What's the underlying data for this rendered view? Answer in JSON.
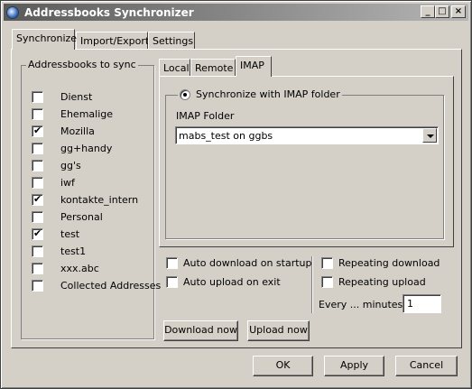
{
  "window": {
    "title": "Addressbooks Synchronizer"
  },
  "title_buttons": {
    "minimize": "_",
    "maximize": "□",
    "close": "×"
  },
  "main_tabs": [
    {
      "label": "Synchronize",
      "active": true
    },
    {
      "label": "Import/Export",
      "active": false
    },
    {
      "label": "Settings",
      "active": false
    }
  ],
  "addressbooks": {
    "group_label": "Addressbooks to sync",
    "items": [
      {
        "label": "Dienst",
        "checked": false
      },
      {
        "label": "Ehemalige",
        "checked": false
      },
      {
        "label": "Mozilla",
        "checked": true
      },
      {
        "label": "gg+handy",
        "checked": false
      },
      {
        "label": "gg's",
        "checked": false
      },
      {
        "label": "iwf",
        "checked": false
      },
      {
        "label": "kontakte_intern",
        "checked": true
      },
      {
        "label": "Personal",
        "checked": false
      },
      {
        "label": "test",
        "checked": true
      },
      {
        "label": "test1",
        "checked": false
      },
      {
        "label": "xxx.abc",
        "checked": false
      },
      {
        "label": "Collected Addresses",
        "checked": false
      }
    ]
  },
  "sync_tabs": [
    {
      "label": "Local",
      "active": false
    },
    {
      "label": "Remote",
      "active": false
    },
    {
      "label": "IMAP",
      "active": true
    }
  ],
  "imap": {
    "radio_label": "Synchronize with IMAP folder",
    "radio_selected": true,
    "folder_label": "IMAP Folder",
    "folder_value": "mabs_test on ggbs"
  },
  "options": {
    "auto_download": {
      "label": "Auto download on startup",
      "checked": false
    },
    "auto_upload": {
      "label": "Auto upload on exit",
      "checked": false
    },
    "repeating_download": {
      "label": "Repeating download",
      "checked": false
    },
    "repeating_upload": {
      "label": "Repeating upload",
      "checked": false
    },
    "every_label": "Every ... minutes",
    "every_value": "1"
  },
  "actions": {
    "download_now": "Download now",
    "upload_now": "Upload now"
  },
  "dialog_buttons": {
    "ok": "OK",
    "apply": "Apply",
    "cancel": "Cancel"
  },
  "colors": {
    "face": "#d4d0c8",
    "title_start": "#5a5a5a",
    "title_end": "#b5b5b5"
  }
}
